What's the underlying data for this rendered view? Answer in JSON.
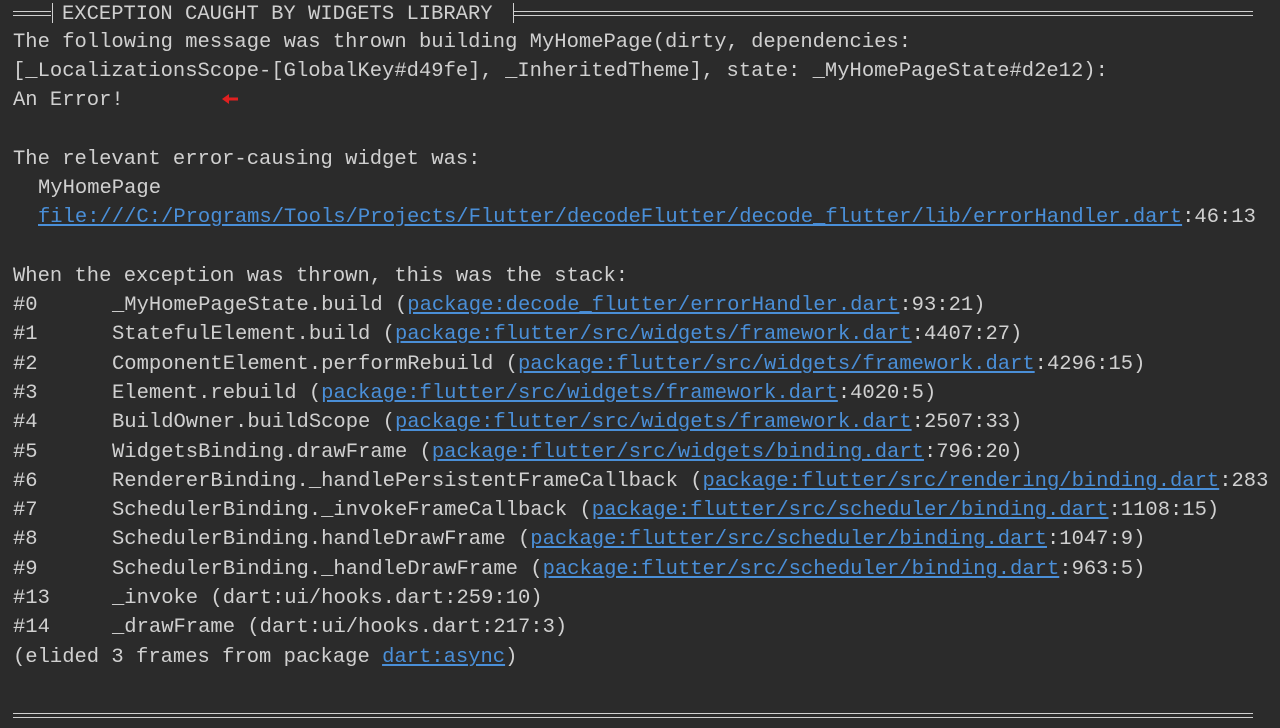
{
  "header": {
    "title": "EXCEPTION CAUGHT BY WIDGETS LIBRARY"
  },
  "message": {
    "line1": "The following message was thrown building MyHomePage(dirty, dependencies:",
    "line2": "[_LocalizationsScope-[GlobalKey#d49fe], _InheritedTheme], state: _MyHomePageState#d2e12):",
    "error": "An Error!"
  },
  "relevant": {
    "heading": "The relevant error-causing widget was:",
    "widget": "MyHomePage",
    "file_link": "file:///C:/Programs/Tools/Projects/Flutter/decodeFlutter/decode_flutter/lib/errorHandler.dart",
    "file_pos": ":46:13"
  },
  "stack": {
    "heading": "When the exception was thrown, this was the stack:",
    "frames": [
      {
        "num": "#0",
        "func": "_MyHomePageState.build",
        "link": "package:decode_flutter/errorHandler.dart",
        "pos": ":93:21)",
        "linked": true
      },
      {
        "num": "#1",
        "func": "StatefulElement.build",
        "link": "package:flutter/src/widgets/framework.dart",
        "pos": ":4407:27)",
        "linked": true
      },
      {
        "num": "#2",
        "func": "ComponentElement.performRebuild",
        "link": "package:flutter/src/widgets/framework.dart",
        "pos": ":4296:15)",
        "linked": true
      },
      {
        "num": "#3",
        "func": "Element.rebuild",
        "link": "package:flutter/src/widgets/framework.dart",
        "pos": ":4020:5)",
        "linked": true
      },
      {
        "num": "#4",
        "func": "BuildOwner.buildScope",
        "link": "package:flutter/src/widgets/framework.dart",
        "pos": ":2507:33)",
        "linked": true
      },
      {
        "num": "#5",
        "func": "WidgetsBinding.drawFrame",
        "link": "package:flutter/src/widgets/binding.dart",
        "pos": ":796:20)",
        "linked": true
      },
      {
        "num": "#6",
        "func": "RendererBinding._handlePersistentFrameCallback",
        "link": "package:flutter/src/rendering/binding.dart",
        "pos": ":283",
        "linked": true
      },
      {
        "num": "#7",
        "func": "SchedulerBinding._invokeFrameCallback",
        "link": "package:flutter/src/scheduler/binding.dart",
        "pos": ":1108:15)",
        "linked": true
      },
      {
        "num": "#8",
        "func": "SchedulerBinding.handleDrawFrame",
        "link": "package:flutter/src/scheduler/binding.dart",
        "pos": ":1047:9)",
        "linked": true
      },
      {
        "num": "#9",
        "func": "SchedulerBinding._handleDrawFrame",
        "link": "package:flutter/src/scheduler/binding.dart",
        "pos": ":963:5)",
        "linked": true
      },
      {
        "num": "#13",
        "func": "_invoke",
        "link": "",
        "pos": "dart:ui/hooks.dart:259:10)",
        "linked": false
      },
      {
        "num": "#14",
        "func": "_drawFrame",
        "link": "",
        "pos": "dart:ui/hooks.dart:217:3)",
        "linked": false
      }
    ],
    "elided_prefix": "(elided 3 frames from package ",
    "elided_link": "dart:async",
    "elided_suffix": ")"
  },
  "colors": {
    "background": "#2b2b2b",
    "text": "#d0d0d0",
    "link": "#4a8fd8",
    "arrow": "#e02020"
  },
  "icons": {
    "arrow": "left-arrow-icon"
  }
}
